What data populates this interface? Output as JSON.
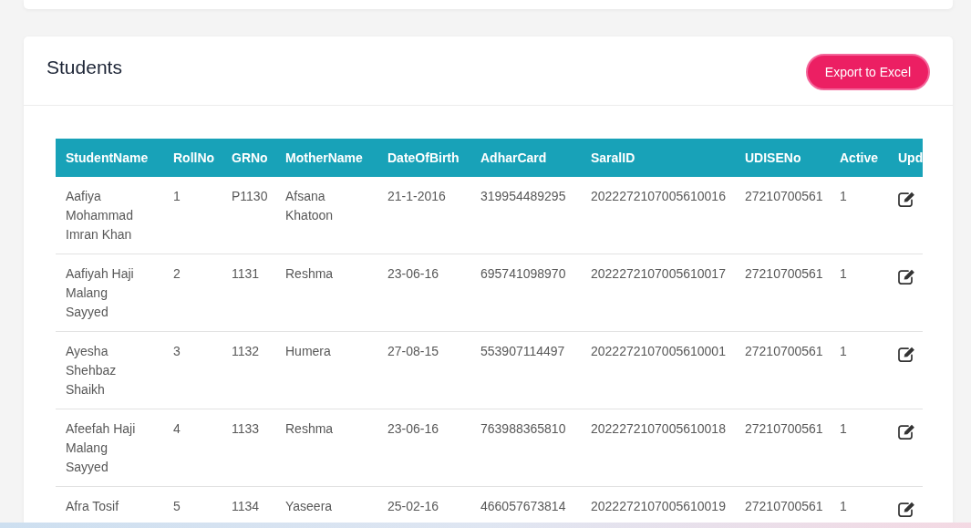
{
  "card": {
    "title": "Students",
    "export_button": "Export to Excel"
  },
  "table": {
    "columns": [
      {
        "label": "StudentName",
        "kind": "text"
      },
      {
        "label": "RollNo",
        "kind": "text"
      },
      {
        "label": "GRNo",
        "kind": "text"
      },
      {
        "label": "MotherName",
        "kind": "text"
      },
      {
        "label": "DateOfBirth",
        "kind": "text"
      },
      {
        "label": "AdharCard",
        "kind": "text"
      },
      {
        "label": "SaralID",
        "kind": "text"
      },
      {
        "label": "UDISENo",
        "kind": "text"
      },
      {
        "label": "Active",
        "kind": "text"
      },
      {
        "label": "Upd",
        "kind": "action"
      }
    ],
    "rows": [
      {
        "cells": [
          "Aafiya Mohammad Imran Khan",
          "1",
          "P1130",
          "Afsana Khatoon",
          "21-1-2016",
          "319954489295",
          "2022272107005610016",
          "27210700561",
          "1"
        ]
      },
      {
        "cells": [
          "Aafiyah Haji Malang Sayyed",
          "2",
          "1131",
          "Reshma",
          "23-06-16",
          "695741098970",
          "2022272107005610017",
          "27210700561",
          "1"
        ]
      },
      {
        "cells": [
          "Ayesha Shehbaz Shaikh",
          "3",
          "1132",
          "Humera",
          "27-08-15",
          "553907114497",
          "2022272107005610001",
          "27210700561",
          "1"
        ]
      },
      {
        "cells": [
          "Afeefah Haji Malang Sayyed",
          "4",
          "1133",
          "Reshma",
          "23-06-16",
          "763988365810",
          "2022272107005610018",
          "27210700561",
          "1"
        ]
      },
      {
        "cells": [
          "Afra Tosif",
          "5",
          "1134",
          "Yaseera",
          "25-02-16",
          "466057673814",
          "2022272107005610019",
          "27210700561",
          "1"
        ]
      }
    ]
  }
}
